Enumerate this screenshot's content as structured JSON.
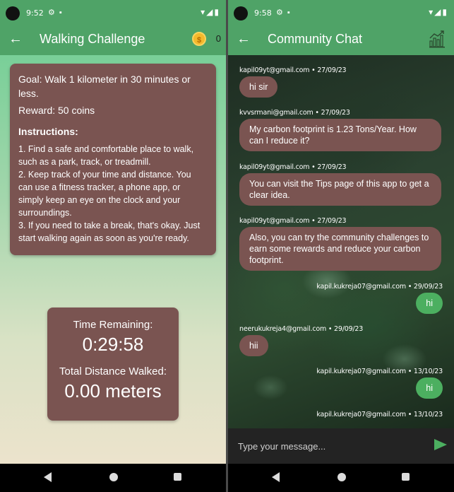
{
  "left_screen": {
    "status": {
      "time": "9:52"
    },
    "appbar": {
      "title": "Walking Challenge",
      "coin_icon": "coin-icon",
      "coins": "0"
    },
    "goal": "Goal: Walk 1 kilometer in 30 minutes or less.",
    "reward": "Reward: 50 coins",
    "instructions_title": "Instructions:",
    "instructions": [
      "1. Find a safe and comfortable place to walk, such as a park, track, or treadmill.",
      "2. Keep track of your time and distance. You can use a fitness tracker, a phone app, or simply keep an eye on the clock and your surroundings.",
      "3. If you need to take a break, that's okay. Just start walking again as soon as you're ready."
    ],
    "timer": {
      "time_label": "Time Remaining:",
      "time_value": "0:29:58",
      "distance_label": "Total Distance Walked:",
      "distance_value": "0.00 meters"
    }
  },
  "right_screen": {
    "status": {
      "time": "9:58"
    },
    "appbar": {
      "title": "Community Chat",
      "icon": "chart-icon"
    },
    "messages": [
      {
        "meta": "kapil09yt@gmail.com • 27/09/23",
        "text": "hi sir",
        "mine": false
      },
      {
        "meta": "kvvsrmani@gmail.com • 27/09/23",
        "text": "My carbon footprint is 1.23 Tons/Year. How can I reduce it?",
        "mine": false
      },
      {
        "meta": "kapil09yt@gmail.com • 27/09/23",
        "text": "You can visit the Tips page of this app to get a clear idea.",
        "mine": false
      },
      {
        "meta": "kapil09yt@gmail.com • 27/09/23",
        "text": "Also, you can try the community challenges to earn some rewards and reduce your carbon footprint.",
        "mine": false
      },
      {
        "meta": "kapil.kukreja07@gmail.com • 29/09/23",
        "text": "hi",
        "mine": true
      },
      {
        "meta": "neerukukreja4@gmail.com • 29/09/23",
        "text": "hii",
        "mine": false
      },
      {
        "meta": "kapil.kukreja07@gmail.com • 13/10/23",
        "text": "hi",
        "mine": true
      },
      {
        "meta": "kapil.kukreja07@gmail.com • 13/10/23",
        "text": "",
        "mine": true
      }
    ],
    "input_placeholder": "Type your message...",
    "colors": {
      "incoming_bubble": "#7a5451",
      "outgoing_bubble": "#4caf60",
      "appbar": "#4fa367"
    }
  }
}
